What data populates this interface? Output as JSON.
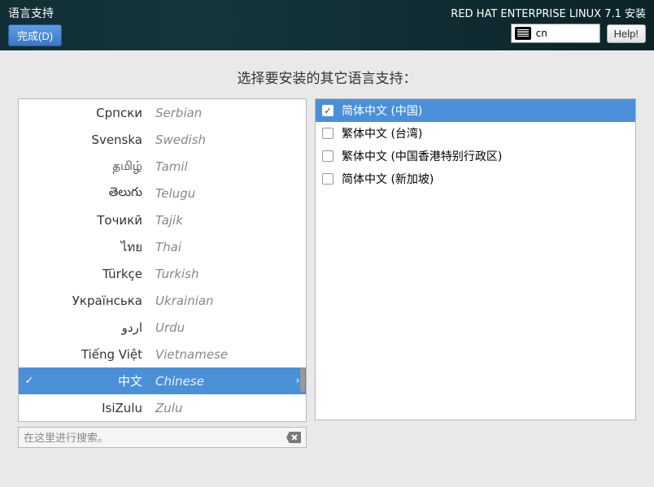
{
  "topbar": {
    "title": "语言支持",
    "done_label": "完成(D)",
    "product": "RED HAT ENTERPRISE LINUX 7.1 安装",
    "keyboard_layout": "cn",
    "help_label": "Help!"
  },
  "heading": "选择要安装的其它语言支持：",
  "search": {
    "placeholder": "在这里进行搜索。"
  },
  "languages": [
    {
      "native": "Српски",
      "english": "Serbian",
      "selected": false
    },
    {
      "native": "Svenska",
      "english": "Swedish",
      "selected": false
    },
    {
      "native": "தமிழ்",
      "english": "Tamil",
      "selected": false
    },
    {
      "native": "తెలుగు",
      "english": "Telugu",
      "selected": false
    },
    {
      "native": "Точикӣ",
      "english": "Tajik",
      "selected": false
    },
    {
      "native": "ไทย",
      "english": "Thai",
      "selected": false
    },
    {
      "native": "Türkçe",
      "english": "Turkish",
      "selected": false
    },
    {
      "native": "Українська",
      "english": "Ukrainian",
      "selected": false
    },
    {
      "native": "اردو",
      "english": "Urdu",
      "selected": false
    },
    {
      "native": "Tiếng Việt",
      "english": "Vietnamese",
      "selected": false
    },
    {
      "native": "中文",
      "english": "Chinese",
      "selected": true
    },
    {
      "native": "IsiZulu",
      "english": "Zulu",
      "selected": false
    }
  ],
  "locales": [
    {
      "label": "简体中文 (中国)",
      "checked": true,
      "selected": true
    },
    {
      "label": "繁体中文 (台湾)",
      "checked": false,
      "selected": false
    },
    {
      "label": "繁体中文 (中国香港特别行政区)",
      "checked": false,
      "selected": false
    },
    {
      "label": "简体中文 (新加坡)",
      "checked": false,
      "selected": false
    }
  ]
}
